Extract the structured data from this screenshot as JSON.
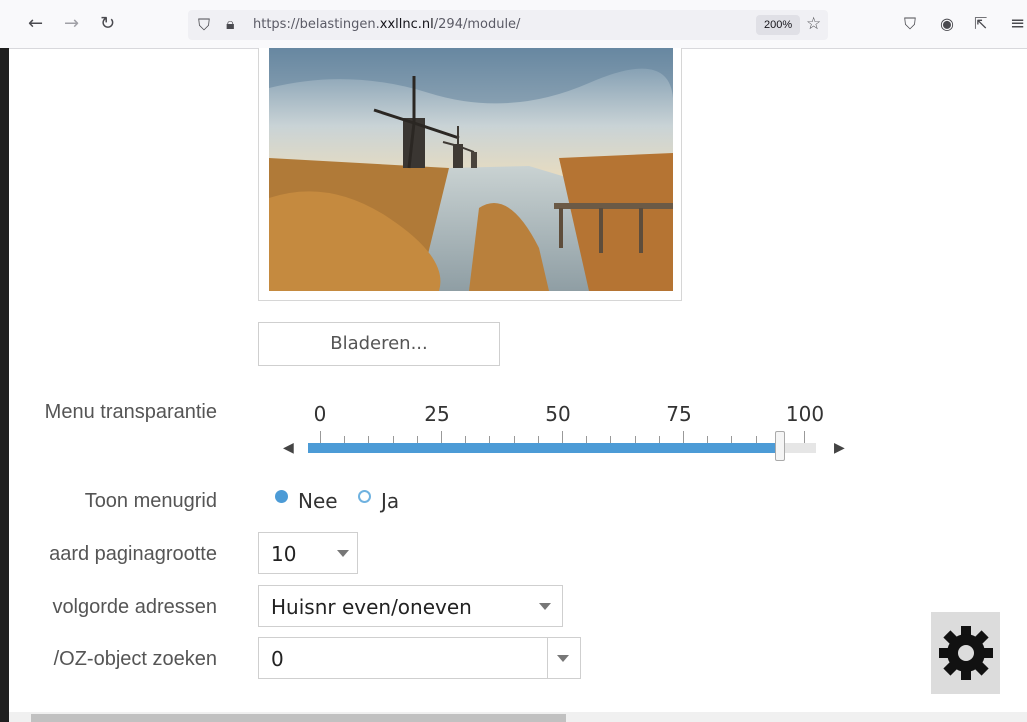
{
  "browser": {
    "url_prefix": "https://belastingen.",
    "url_domain": "xxllnc.nl",
    "url_path": "/294/module/",
    "zoom": "200%"
  },
  "form": {
    "browse_label": "Bladeren...",
    "menu_transparency": {
      "label": "Menu transparantie",
      "ticks": [
        "0",
        "25",
        "50",
        "75",
        "100"
      ],
      "value": 95
    },
    "menu_grid": {
      "label": "Toon menugrid",
      "options": [
        "Nee",
        "Ja"
      ],
      "selected": "Nee"
    },
    "page_size": {
      "label": "aard paginagrootte",
      "value": "10"
    },
    "address_order": {
      "label": "volgorde adressen",
      "value": "Huisnr even/oneven"
    },
    "woz_search": {
      "label": "/OZ-object zoeken",
      "value": "0"
    }
  },
  "colors": {
    "accent": "#4c9bd6"
  }
}
